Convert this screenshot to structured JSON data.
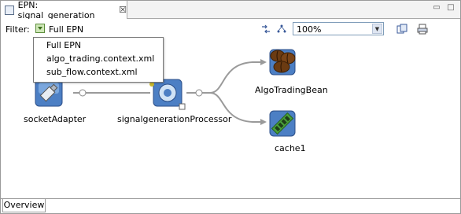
{
  "tab": {
    "title": "EPN: signal_generation",
    "close": "☒"
  },
  "toolbar": {
    "filter_label": "Filter:",
    "filter_value": "Full EPN",
    "zoom_value": "100%"
  },
  "filter_menu": {
    "items": [
      "Full EPN",
      "algo_trading.context.xml",
      "sub_flow.context.xml"
    ]
  },
  "nodes": {
    "socket": "socketAdapter",
    "processor": "signalgenerationProcessor",
    "bean": "AlgoTradingBean",
    "cache": "cache1"
  },
  "bottom": {
    "tab": "Overview"
  }
}
